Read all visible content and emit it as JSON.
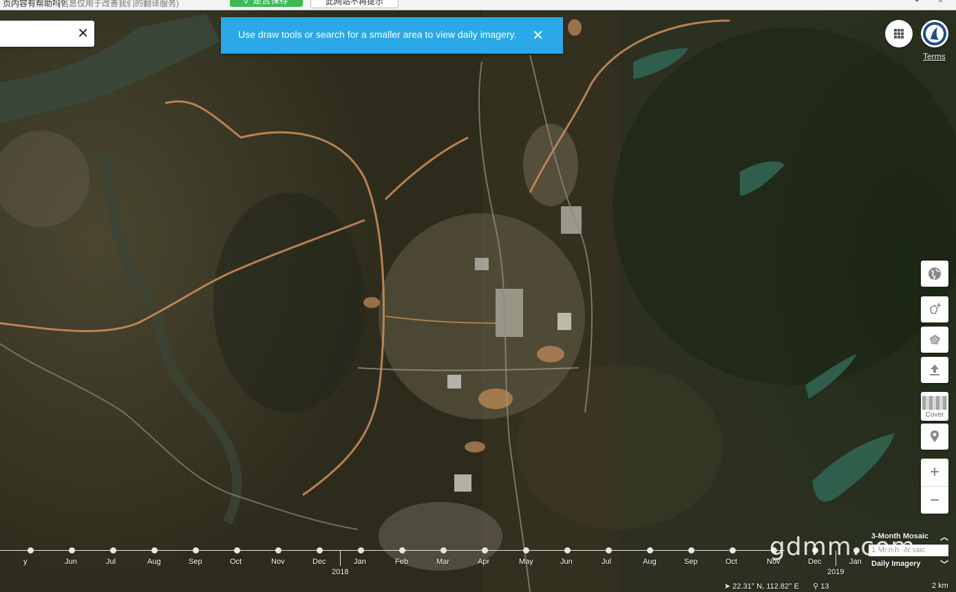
{
  "topbar": {
    "question_text": "页内容有帮助吗?",
    "hint_text": "(信息仅用于改善我们的翻译服务)",
    "green_button_label": "✓ 是否保存",
    "white_button_label": "此网站不再提示",
    "icons": [
      "pin-icon",
      "close-icon"
    ]
  },
  "search": {
    "value": "",
    "placeholder": "",
    "clear_glyph": "✕"
  },
  "toast": {
    "message": "Use draw tools or search for a smaller area to view daily imagery.",
    "close_glyph": "✕"
  },
  "header": {
    "terms_label": "Terms",
    "apps_icon": "apps-grid-icon",
    "avatar_icon": "planet-logo-icon"
  },
  "tools": {
    "basemap_icon": "globe-icon",
    "draw_icon": "draw-polygon-icon",
    "aoi_icon": "area-shape-icon",
    "upload_icon": "upload-icon",
    "cover_label": "Cover",
    "place_icon": "location-pin-icon",
    "zoom_in": "+",
    "zoom_out": "−"
  },
  "timeline": {
    "months": [
      {
        "label": "y"
      },
      {
        "label": "Jun"
      },
      {
        "label": "Jul"
      },
      {
        "label": "Aug"
      },
      {
        "label": "Sep"
      },
      {
        "label": "Oct"
      },
      {
        "label": "Nov"
      },
      {
        "label": "Dec"
      },
      {
        "label": "Jan"
      },
      {
        "label": "Feb"
      },
      {
        "label": "Mar"
      },
      {
        "label": "Apr"
      },
      {
        "label": "May"
      },
      {
        "label": "Jun"
      },
      {
        "label": "Jul"
      },
      {
        "label": "Aug"
      },
      {
        "label": "Sep"
      },
      {
        "label": "Oct"
      },
      {
        "label": "Nov"
      },
      {
        "label": "Dec"
      },
      {
        "label": "Jan"
      }
    ],
    "years": [
      "2018",
      "2019"
    ]
  },
  "layers": {
    "mosaic_label": "3-Month Mosaic",
    "middle_label": "1-Month Mosaic",
    "daily_label": "Daily Imagery"
  },
  "status": {
    "coordinates": "22.31° N, 112.82° E",
    "zoom_level": "13",
    "scale": "2 km"
  },
  "watermark": "gdmm.com"
}
